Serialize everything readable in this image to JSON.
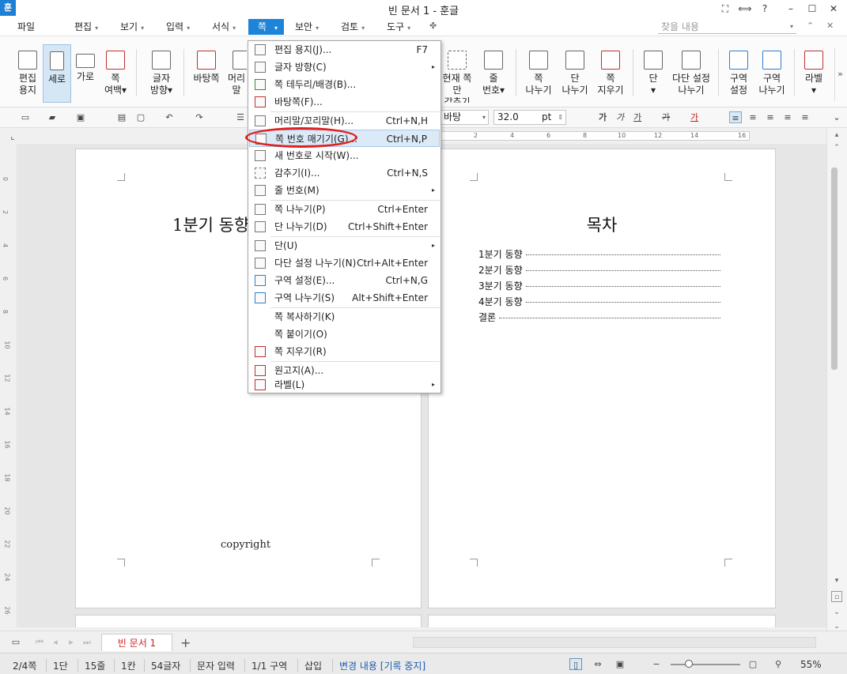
{
  "window": {
    "title": "빈 문서 1 - 훈글",
    "logo": "훈"
  },
  "window_controls": [
    "⛶",
    "⟺",
    "?",
    "–",
    "☐",
    "✕"
  ],
  "menu": {
    "items": [
      {
        "label": "파일",
        "arrow": ""
      },
      {
        "label": "편집",
        "arrow": "▾"
      },
      {
        "label": "보기",
        "arrow": "▾"
      },
      {
        "label": "입력",
        "arrow": "▾"
      },
      {
        "label": "서식",
        "arrow": "▾"
      },
      {
        "label": "쪽",
        "arrow": "▾"
      },
      {
        "label": "보안",
        "arrow": "▾"
      },
      {
        "label": "검토",
        "arrow": "▾"
      },
      {
        "label": "도구",
        "arrow": "▾"
      }
    ],
    "find_placeholder": "찾을 내용"
  },
  "ribbon": {
    "buttons": [
      {
        "label1": "편집",
        "label2": "용지"
      },
      {
        "label1": "세로",
        "label2": ""
      },
      {
        "label1": "가로",
        "label2": ""
      },
      {
        "label1": "쪽",
        "label2": "여백▾"
      },
      {
        "label1": "글자",
        "label2": "방향▾"
      },
      {
        "label1": "바탕쪽",
        "label2": ""
      },
      {
        "label1": "머리말",
        "label2": ""
      },
      {
        "label1": "현재 쪽만",
        "label2": "감추기"
      },
      {
        "label1": "줄",
        "label2": "번호▾"
      },
      {
        "label1": "쪽",
        "label2": "나누기"
      },
      {
        "label1": "단",
        "label2": "나누기"
      },
      {
        "label1": "쪽",
        "label2": "지우기"
      },
      {
        "label1": "단",
        "label2": "▾"
      },
      {
        "label1": "다단 설정",
        "label2": "나누기"
      },
      {
        "label1": "구역",
        "label2": "설정"
      },
      {
        "label1": "구역",
        "label2": "나누기"
      },
      {
        "label1": "라벨",
        "label2": "▾"
      }
    ]
  },
  "format_bar": {
    "font": "바탕",
    "size": "32.0",
    "unit": "pt",
    "bold": "가",
    "italic": "가",
    "underline": "가",
    "strike": "가",
    "color": "가"
  },
  "ruler_numbers": [
    "2",
    "4",
    "6",
    "8",
    "10",
    "12",
    "14",
    "16"
  ],
  "vruler_numbers": [
    "0",
    "2",
    "4",
    "6",
    "8",
    "10",
    "12",
    "14",
    "16",
    "18",
    "20",
    "22",
    "24",
    "26"
  ],
  "document": {
    "left_heading": "1분기 동향",
    "left_footer": "copyright",
    "right_heading": "목차",
    "toc": [
      "1분기 동향",
      "2분기 동향",
      "3분기 동향",
      "4분기 동향",
      "결론"
    ]
  },
  "dropdown": {
    "items": [
      {
        "label": "편집 용지(J)...",
        "shortcut": "F7",
        "sub": ""
      },
      {
        "label": "글자 방향(C)",
        "shortcut": "",
        "sub": "▸"
      },
      {
        "label": "쪽 테두리/배경(B)...",
        "shortcut": "",
        "sub": ""
      },
      {
        "label": "바탕쪽(F)...",
        "shortcut": "",
        "sub": ""
      },
      {
        "label": "머리말/꼬리말(H)...",
        "shortcut": "Ctrl+N,H",
        "sub": ""
      },
      {
        "label": "쪽 번호 매기기(G)...",
        "shortcut": "Ctrl+N,P",
        "sub": ""
      },
      {
        "label": "새 번호로 시작(W)...",
        "shortcut": "",
        "sub": ""
      },
      {
        "label": "감추기(I)...",
        "shortcut": "Ctrl+N,S",
        "sub": ""
      },
      {
        "label": "줄 번호(M)",
        "shortcut": "",
        "sub": "▸"
      },
      {
        "label": "쪽 나누기(P)",
        "shortcut": "Ctrl+Enter",
        "sub": ""
      },
      {
        "label": "단 나누기(D)",
        "shortcut": "Ctrl+Shift+Enter",
        "sub": ""
      },
      {
        "label": "단(U)",
        "shortcut": "",
        "sub": "▸"
      },
      {
        "label": "다단 설정 나누기(N)",
        "shortcut": "Ctrl+Alt+Enter",
        "sub": ""
      },
      {
        "label": "구역 설정(E)...",
        "shortcut": "Ctrl+N,G",
        "sub": ""
      },
      {
        "label": "구역 나누기(S)",
        "shortcut": "Alt+Shift+Enter",
        "sub": ""
      },
      {
        "label": "쪽 복사하기(K)",
        "shortcut": "",
        "sub": ""
      },
      {
        "label": "쪽 붙이기(O)",
        "shortcut": "",
        "sub": ""
      },
      {
        "label": "쪽 지우기(R)",
        "shortcut": "",
        "sub": ""
      },
      {
        "label": "원고지(A)...",
        "shortcut": "",
        "sub": ""
      },
      {
        "label": "라벨(L)",
        "shortcut": "",
        "sub": "▸"
      }
    ]
  },
  "tab": {
    "name": "빈 문서 1",
    "add": "+"
  },
  "status": {
    "page": "2/4쪽",
    "column": "1단",
    "line": "15줄",
    "col": "1칸",
    "chars": "54글자",
    "mode": "문자 입력",
    "section": "1/1 구역",
    "insert": "삽입",
    "track": "변경 내용 [기록 중지]",
    "zoom": "55%"
  }
}
